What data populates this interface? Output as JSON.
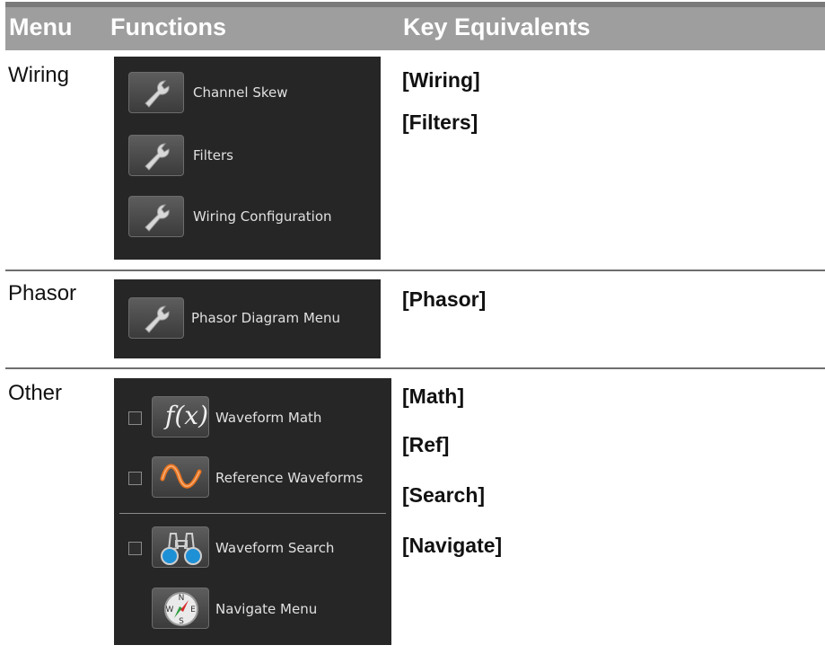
{
  "header": {
    "menu": "Menu",
    "functions": "Functions",
    "keys": "Key Equivalents"
  },
  "rows": [
    {
      "label": "Wiring",
      "items": [
        {
          "label": "Channel Skew",
          "icon": "wrench-icon"
        },
        {
          "label": "Filters",
          "icon": "wrench-icon"
        },
        {
          "label": "Wiring Configuration",
          "icon": "wrench-icon"
        }
      ],
      "keys": [
        "[Wiring]",
        "[Filters]"
      ]
    },
    {
      "label": "Phasor",
      "items": [
        {
          "label": "Phasor Diagram Menu",
          "icon": "wrench-icon"
        }
      ],
      "keys": [
        "[Phasor]"
      ]
    },
    {
      "label": "Other",
      "items": [
        {
          "label": "Waveform Math",
          "icon": "function-fx-icon",
          "fx_text": "f(x)"
        },
        {
          "label": "Reference Waveforms",
          "icon": "sine-wave-icon"
        },
        {
          "label": "Waveform Search",
          "icon": "binoculars-icon"
        },
        {
          "label": "Navigate Menu",
          "icon": "compass-icon",
          "compass_letters": [
            "N",
            "E",
            "S",
            "W"
          ]
        }
      ],
      "keys": [
        "[Math]",
        "[Ref]",
        "[Search]",
        "[Navigate]"
      ]
    }
  ],
  "colors": {
    "header_bg": "#9e9e9e",
    "panel_bg": "#262626",
    "sine_wave": "#e8731f",
    "binocular_lens": "#1e90d6"
  }
}
